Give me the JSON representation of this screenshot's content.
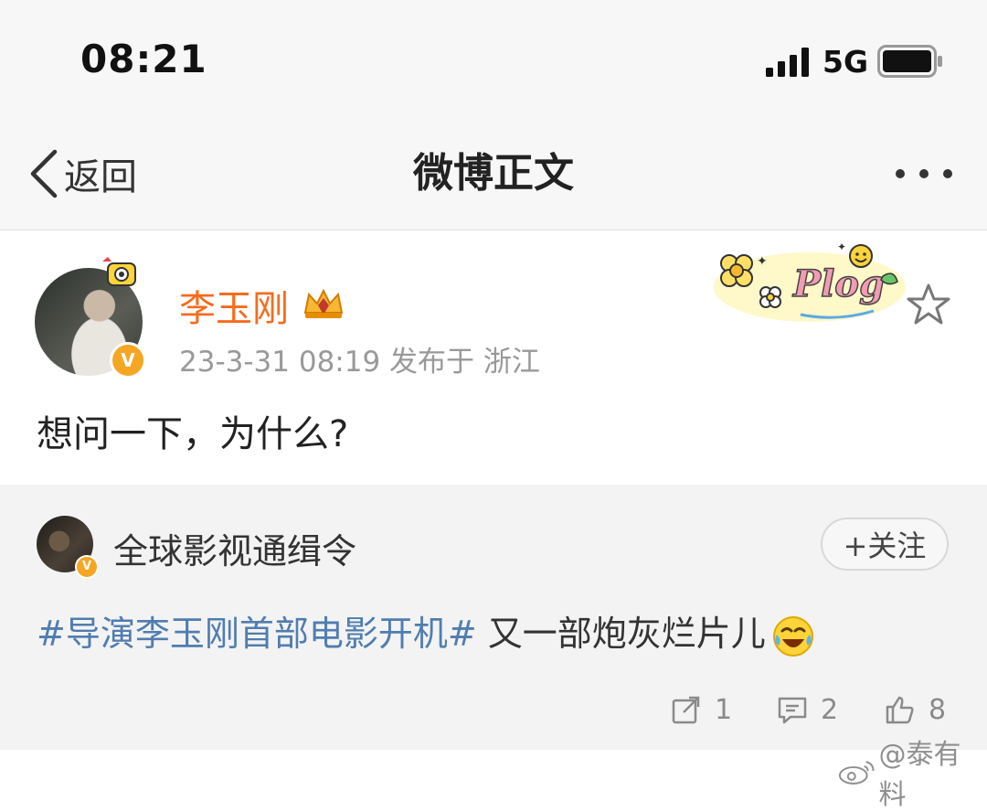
{
  "status_bar": {
    "time": "08:21",
    "network": "5G"
  },
  "nav": {
    "back_label": "返回",
    "title": "微博正文",
    "more_icon": "more-dots-icon"
  },
  "post": {
    "author": "李玉刚",
    "verified_mark": "V",
    "meta": "23-3-31 08:19  发布于 浙江",
    "sticker_text": "Plog",
    "text": "想问一下，为什么?"
  },
  "retweet": {
    "author": "全球影视通缉令",
    "verified_mark": "V",
    "follow_label": "+关注",
    "hashtag": "#导演李玉刚首部电影开机#",
    "text": " 又一部炮灰烂片儿",
    "emoji": "laugh-cry-emoji",
    "actions": {
      "repost_count": "1",
      "comment_count": "2",
      "like_count": "8"
    }
  },
  "watermark": "@泰有料",
  "colors": {
    "author_orange": "#f76b1c",
    "hashtag_blue": "#507daf",
    "badge_gold": "#f5a623"
  }
}
